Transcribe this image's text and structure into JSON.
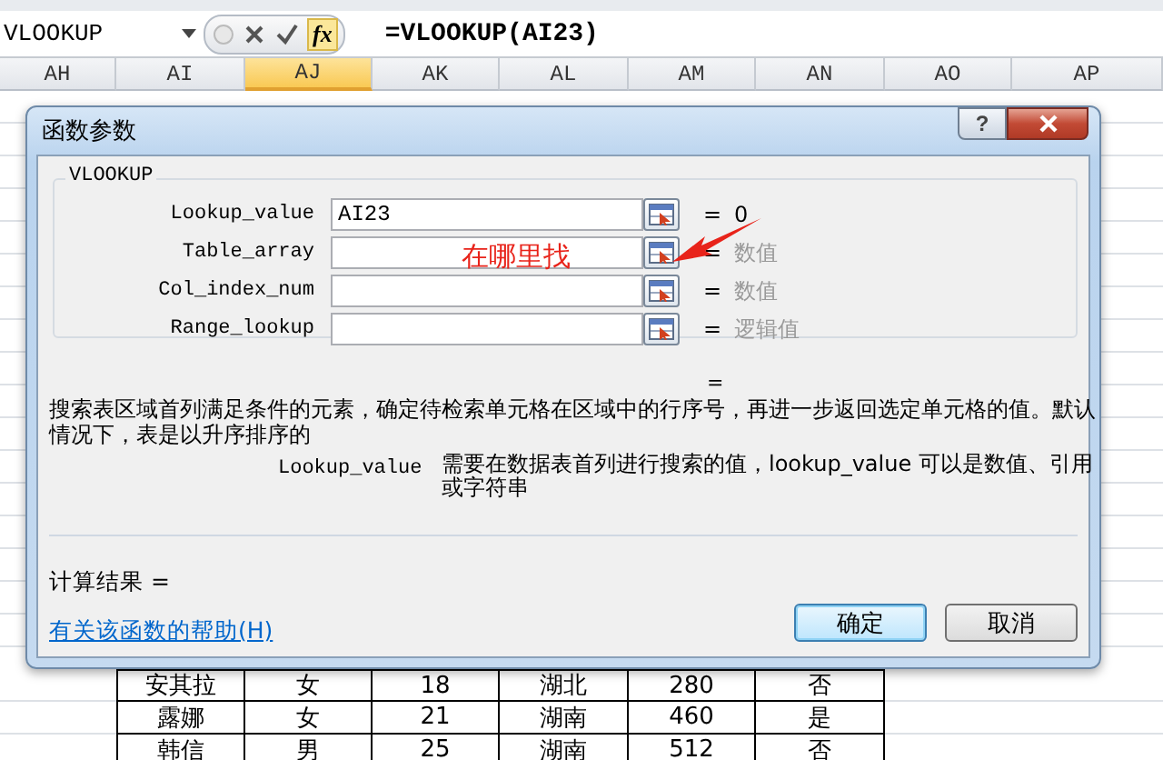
{
  "formula_bar": {
    "name_box": "VLOOKUP",
    "function_button": "fx",
    "formula": "=VLOOKUP(AI23)"
  },
  "columns": [
    {
      "label": "AH",
      "selected": false
    },
    {
      "label": "AI",
      "selected": false
    },
    {
      "label": "AJ",
      "selected": true
    },
    {
      "label": "AK",
      "selected": false
    },
    {
      "label": "AL",
      "selected": false
    },
    {
      "label": "AM",
      "selected": false
    },
    {
      "label": "AN",
      "selected": false
    },
    {
      "label": "AO",
      "selected": false
    },
    {
      "label": "AP",
      "selected": false
    }
  ],
  "rows": [
    [
      "安其拉",
      "女",
      "18",
      "湖北",
      "280",
      "否"
    ],
    [
      "露娜",
      "女",
      "21",
      "湖南",
      "460",
      "是"
    ],
    [
      "韩信",
      "男",
      "25",
      "湖南",
      "512",
      "否"
    ]
  ],
  "dialog": {
    "title": "函数参数",
    "help_button": "?",
    "group_title": "VLOOKUP",
    "args": [
      {
        "name": "Lookup_value",
        "value": "AI23",
        "equals": "=",
        "result": "0",
        "hint": false
      },
      {
        "name": "Table_array",
        "equals": "=",
        "result": "数值",
        "hint": true
      },
      {
        "name": "Col_index_num",
        "equals": "=",
        "result": "数值",
        "hint": true
      },
      {
        "name": "Range_lookup",
        "equals": "=",
        "result": "逻辑值",
        "hint": true
      }
    ],
    "annotation": "在哪里找",
    "formula_result": "=",
    "description": "搜索表区域首列满足条件的元素，确定待检索单元格在区域中的行序号，再进一步返回选定单元格的值。默认情况下，表是以升序排序的",
    "arg_help_name": "Lookup_value",
    "arg_help_text": "需要在数据表首列进行搜索的值，lookup_value 可以是数值、引用或字符串",
    "calc_result": "计算结果 =",
    "help_link": "有关该函数的帮助(H)",
    "buttons": [
      {
        "label": "确定",
        "default": true
      },
      {
        "label": "取消",
        "default": false
      }
    ]
  }
}
